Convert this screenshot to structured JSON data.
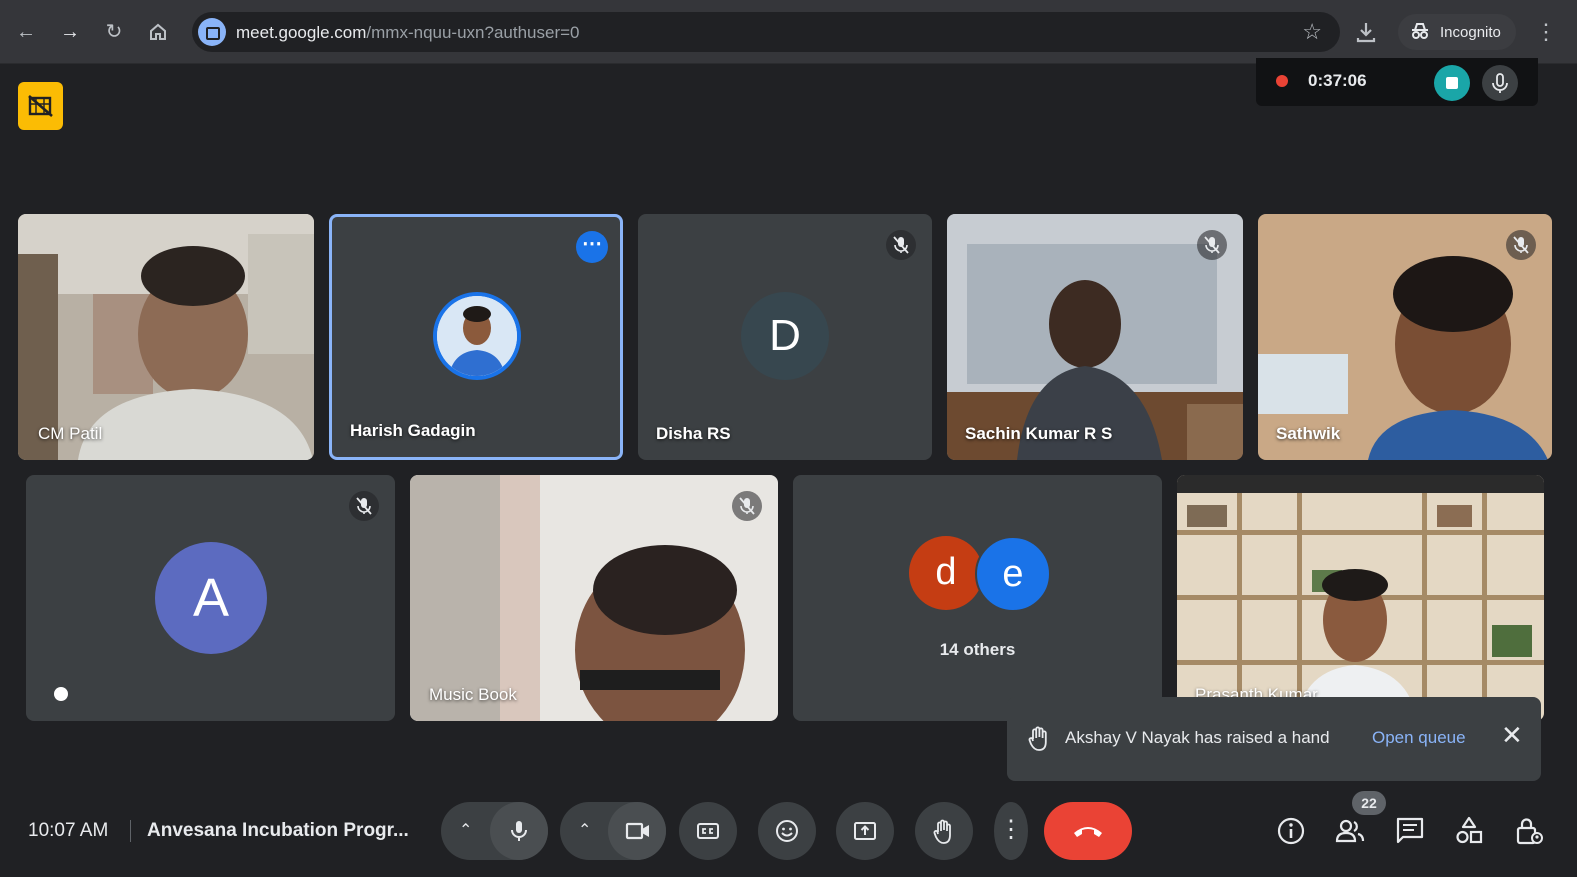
{
  "browser": {
    "url_host": "meet.google.com",
    "url_rest": "/mmx-nquu-uxn?authuser=0",
    "incognito_label": "Incognito"
  },
  "recording": {
    "elapsed": "0:37:06"
  },
  "tiles": {
    "t1": {
      "name": "CM Patil"
    },
    "t2": {
      "name": "Harish Gadagin"
    },
    "t3": {
      "name": "Disha RS",
      "initial": "D"
    },
    "t4": {
      "name": "Sachin Kumar R S"
    },
    "t5": {
      "name": "Sathwik"
    },
    "t6": {
      "initial": "A"
    },
    "t7": {
      "name": "Music Book"
    },
    "t8": {
      "initial_1": "d",
      "initial_2": "e",
      "others_label": "14 others"
    },
    "t9": {
      "name": "Prasanth Kumar"
    }
  },
  "notification": {
    "message": "Akshay V Nayak has raised a hand",
    "action": "Open queue"
  },
  "bottom": {
    "time": "10:07 AM",
    "meeting_title": "Anvesana Incubation Progr...",
    "participant_count": "22"
  },
  "colors": {
    "accent_blue": "#8ab4f8",
    "end_call_red": "#ea4335",
    "avatar_disha": "#37474f",
    "avatar_a": "#5c6bc0",
    "avatar_d": "#c53d13",
    "avatar_e": "#1a73e8"
  }
}
